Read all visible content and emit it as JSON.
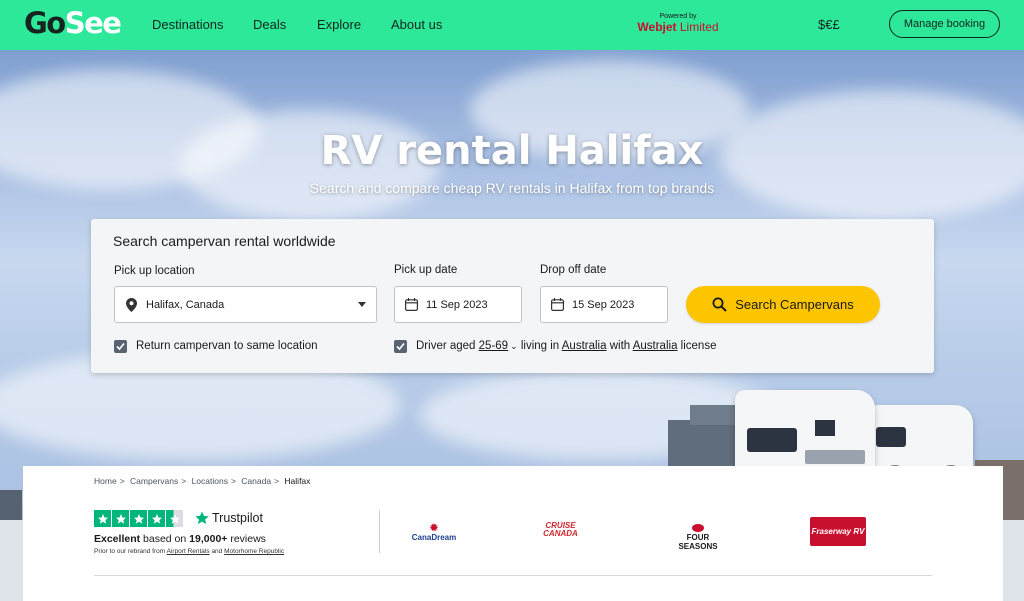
{
  "header": {
    "logo_go": "Go",
    "logo_see": "See",
    "nav": [
      "Destinations",
      "Deals",
      "Explore",
      "About us"
    ],
    "powered_label": "Powered by",
    "powered_brand_bold": "Webjet",
    "powered_brand_rest": " Limited",
    "currency": "$€£",
    "manage_booking": "Manage booking",
    "accent_color": "#2ee89a"
  },
  "hero": {
    "title": "RV rental Halifax",
    "subtitle": "Search and compare cheap RV rentals in Halifax from top brands"
  },
  "search": {
    "title": "Search campervan rental worldwide",
    "pickup_location_label": "Pick up location",
    "pickup_location_value": "Halifax, Canada",
    "pickup_date_label": "Pick up date",
    "pickup_date_value": "11 Sep 2023",
    "dropoff_date_label": "Drop off date",
    "dropoff_date_value": "15 Sep 2023",
    "search_button": "Search Campervans",
    "button_color": "#fcc500",
    "return_same_location": "Return campervan to same location",
    "driver_prefix": "Driver aged",
    "driver_age": "25-69",
    "living_in": "living in",
    "living_country": "Australia",
    "with": "with",
    "license_country": "Australia",
    "license": "license"
  },
  "breadcrumb": [
    "Home",
    "Campervans",
    "Locations",
    "Canada",
    "Halifax"
  ],
  "trustpilot": {
    "name": "Trustpilot",
    "rating_word": "Excellent",
    "based_on": "based on",
    "review_count": "19,000+",
    "reviews_word": "reviews",
    "note_prefix": "Prior to our rebrand from",
    "note_link1": "Airport Rentals",
    "note_and": "and",
    "note_link2": "Motorhome Republic",
    "star_color": "#00b67a"
  },
  "brands": [
    {
      "name": "CanaDream",
      "color": "#1d3f8f"
    },
    {
      "name": "CRUISE CANADA",
      "color": "#d22630"
    },
    {
      "name": "FOUR SEASONS",
      "color": "#1a1a1a"
    },
    {
      "name": "Fraserway RV",
      "color": "#c8102e"
    }
  ]
}
